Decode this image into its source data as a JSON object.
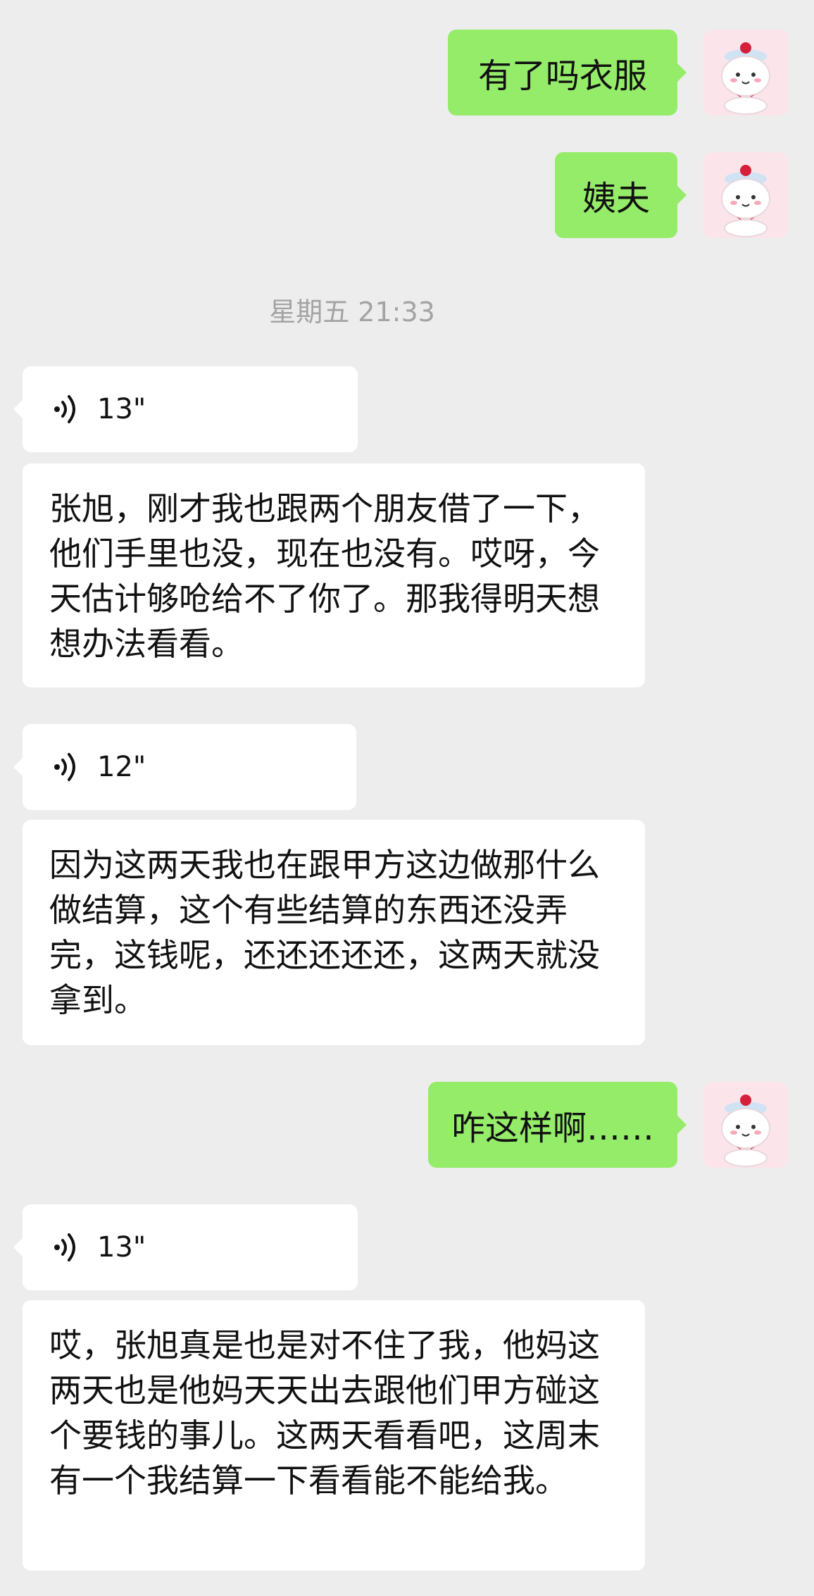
{
  "messages": {
    "sent_1": "有了吗衣服",
    "sent_2": "姨夫",
    "sent_3": "咋这样啊……"
  },
  "timestamp": "星期五 21:33",
  "voice": {
    "v1": "13\"",
    "v2": "12\"",
    "v3": "13\""
  },
  "transcripts": {
    "t1": "张旭，刚才我也跟两个朋友借了一下，他们手里也没，现在也没有。哎呀，今天估计够呛给不了你了。那我得明天想想办法看看。",
    "t2": "因为这两天我也在跟甲方这边做那什么做结算，这个有些结算的东西还没弄完，这钱呢，还还还还还，这两天就没拿到。",
    "t3": "哎，张旭真是也是对不住了我，他妈这两天也是他妈天天出去跟他们甲方碰这个要钱的事儿。这两天看看吧，这周末有一个我结算一下看看能不能给我。"
  },
  "icons": {
    "avatar": "cat-avatar-icon",
    "voice": "voice-wave-icon"
  },
  "colors": {
    "background": "#ededed",
    "sent_bubble": "#95ec69",
    "received_bubble": "#ffffff",
    "timestamp": "#a3a3a3"
  }
}
